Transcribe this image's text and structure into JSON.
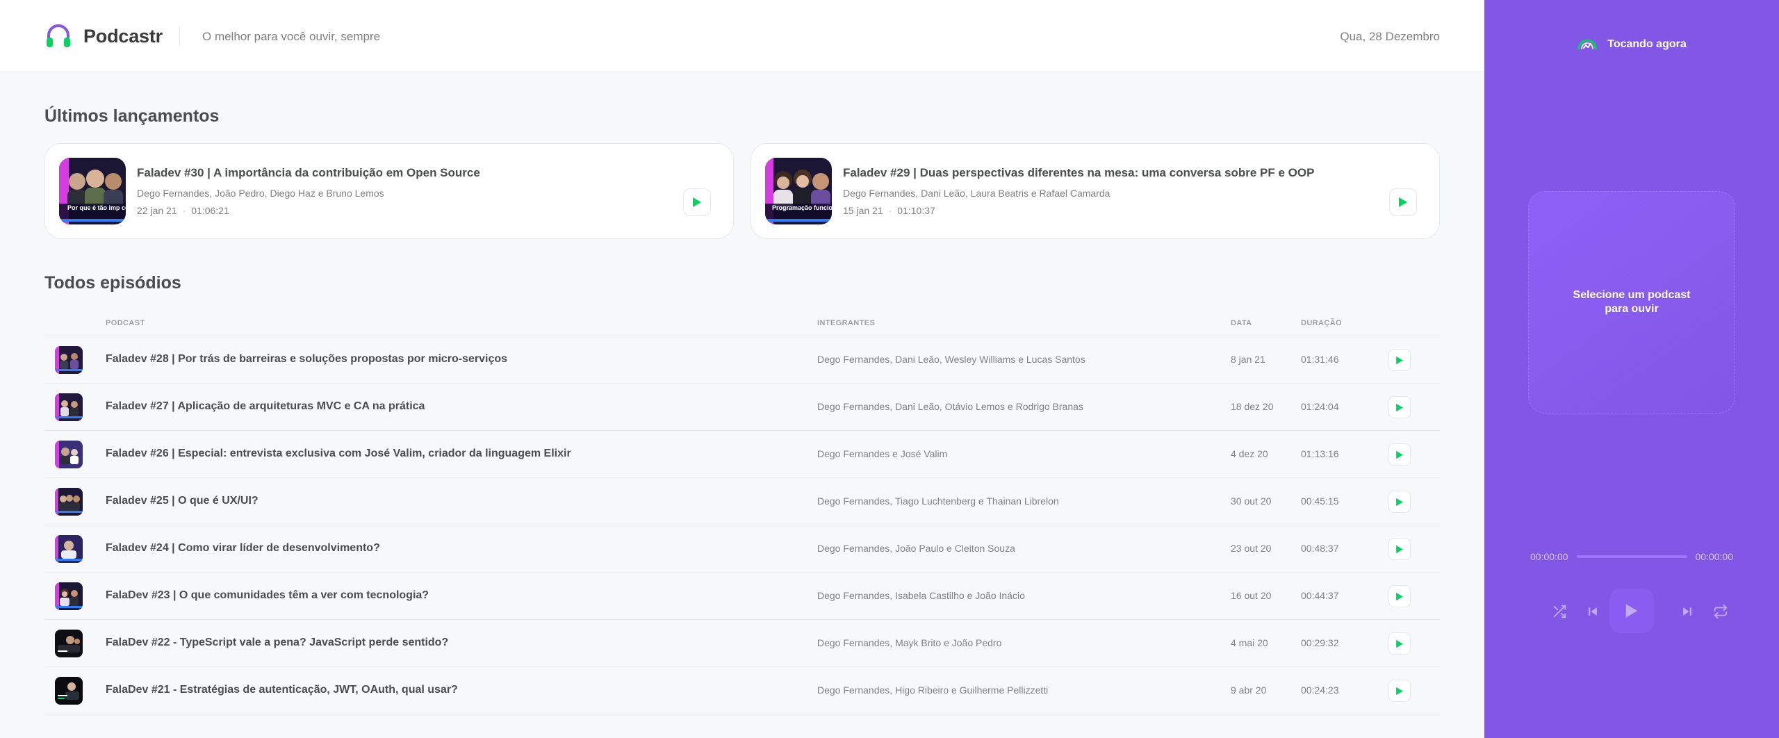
{
  "header": {
    "brand": "Podcastr",
    "tagline": "O melhor para você ouvir, sempre",
    "date": "Qua, 28 Dezembro"
  },
  "latest": {
    "title": "Últimos lançamentos",
    "episodes": [
      {
        "title": "Faladev #30 | A importância da contribuição em Open Source",
        "members": "Dego Fernandes, João Pedro, Diego Haz e Bruno Lemos",
        "date": "22 jan 21",
        "duration": "01:06:21",
        "thumb_caption": "Por que é tão imp contribuir em Open S"
      },
      {
        "title": "Faladev #29 | Duas perspectivas diferentes na mesa: uma conversa sobre PF e OOP",
        "members": "Dego Fernandes, Dani Leão, Laura Beatris e Rafael Camarda",
        "date": "15 jan 21",
        "duration": "01:10:37",
        "thumb_caption": "Programação funcio devs orientados a"
      }
    ]
  },
  "all": {
    "title": "Todos episódios",
    "columns": [
      "Podcast",
      "Integrantes",
      "Data",
      "Duração"
    ],
    "episodes": [
      {
        "title": "Faladev #28 | Por trás de barreiras e soluções propostas por micro-serviços",
        "members": "Dego Fernandes, Dani Leão, Wesley Williams e Lucas Santos",
        "date": "8 jan 21",
        "duration": "01:31:46"
      },
      {
        "title": "Faladev #27 | Aplicação de arquiteturas MVC e CA na prática",
        "members": "Dego Fernandes, Dani Leão, Otávio Lemos e Rodrigo Branas",
        "date": "18 dez 20",
        "duration": "01:24:04"
      },
      {
        "title": "Faladev #26 | Especial: entrevista exclusiva com José Valim, criador da linguagem Elixir",
        "members": "Dego Fernandes e José Valim",
        "date": "4 dez 20",
        "duration": "01:13:16"
      },
      {
        "title": "Faladev #25 | O que é UX/UI?",
        "members": "Dego Fernandes, Tiago Luchtenberg e Thainan Librelon",
        "date": "30 out 20",
        "duration": "00:45:15"
      },
      {
        "title": "Faladev #24 | Como virar líder de desenvolvimento?",
        "members": "Dego Fernandes, João Paulo e Cleiton Souza",
        "date": "23 out 20",
        "duration": "00:48:37"
      },
      {
        "title": "FalaDev #23 | O que comunidades têm a ver com tecnologia?",
        "members": "Dego Fernandes, Isabela Castilho e João Inácio",
        "date": "16 out 20",
        "duration": "00:44:37"
      },
      {
        "title": "FalaDev #22 - TypeScript vale a pena? JavaScript perde sentido?",
        "members": "Dego Fernandes, Mayk Brito e João Pedro",
        "date": "4 mai 20",
        "duration": "00:29:32"
      },
      {
        "title": "FalaDev #21 - Estratégias de autenticação, JWT, OAuth, qual usar?",
        "members": "Dego Fernandes, Higo Ribeiro e Guilherme Pellizzetti",
        "date": "9 abr 20",
        "duration": "00:24:23"
      }
    ]
  },
  "player": {
    "heading": "Tocando agora",
    "empty_text": "Selecione um podcast para ouvir",
    "elapsed": "00:00:00",
    "total": "00:00:00",
    "progress": 0
  },
  "colors": {
    "purple": "#8257E5",
    "purple_light": "#9164FA",
    "green": "#04D361",
    "text": "#494D4B",
    "muted": "#808080",
    "line": "#E6E8EB"
  },
  "icons": [
    "headphones-icon",
    "play-icon",
    "shuffle-icon",
    "previous-icon",
    "next-icon",
    "repeat-icon",
    "playing-now-icon"
  ]
}
